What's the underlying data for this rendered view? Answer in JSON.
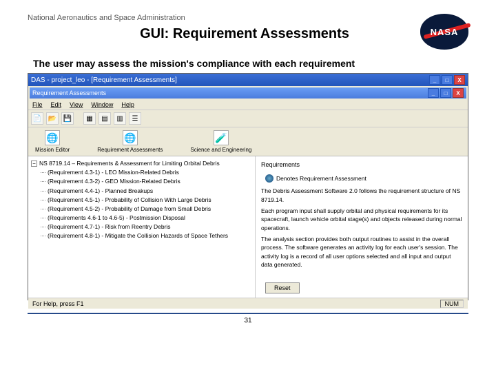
{
  "slide": {
    "org": "National Aeronautics and Space Administration",
    "title": "GUI: Requirement Assessments",
    "subtitle": "The user may assess the mission's compliance with each requirement",
    "page_number": "31"
  },
  "logo": {
    "text": "NASA"
  },
  "window": {
    "title": "DAS - project_leo - [Requirement Assessments]",
    "inner_title": "Requirement Assessments",
    "menus": [
      "File",
      "Edit",
      "View",
      "Window",
      "Help"
    ],
    "toolbar_icons": [
      "new",
      "open",
      "save",
      "sep",
      "grid1",
      "grid2",
      "grid3",
      "list"
    ],
    "iconbar": [
      {
        "glyph": "🌐",
        "label": "Mission Editor"
      },
      {
        "glyph": "🌐",
        "label": "Requirement Assessments"
      },
      {
        "glyph": "🧪",
        "label": "Science and Engineering"
      }
    ],
    "tree": {
      "root": "NS 8719.14 – Requirements & Assessment for Limiting Orbital Debris",
      "items": [
        "(Requirement 4.3-1) - LEO Mission-Related Debris",
        "(Requirement 4.3-2) - GEO Mission-Related Debris",
        "(Requirement 4.4-1) - Planned Breakups",
        "(Requirement 4.5-1) - Probability of Collision With Large Debris",
        "(Requirement 4.5-2) - Probability of Damage from Small Debris",
        "(Requirements 4.6-1 to 4.6-5) - Postmission Disposal",
        "(Requirement 4.7-1) - Risk from Reentry Debris",
        "(Requirement 4.8-1) - Mitigate the Collision Hazards of Space Tethers"
      ]
    },
    "panel": {
      "heading": "Requirements",
      "legend": "Denotes Requirement Assessment",
      "body": [
        "The Debris Assessment Software 2.0 follows the requirement structure of NS 8719.14.",
        "Each program input shall supply orbital and physical requirements for its spacecraft, launch vehicle orbital stage(s) and objects released during normal operations.",
        "The analysis section provides both output routines to assist in the overall process. The software generates an activity log for each user's session. The activity log is a record of all user options selected and all input and output data generated."
      ],
      "reset": "Reset"
    },
    "status": {
      "left": "For Help, press F1",
      "right": "NUM"
    },
    "win_controls": {
      "min": "_",
      "max": "□",
      "close": "X"
    }
  }
}
